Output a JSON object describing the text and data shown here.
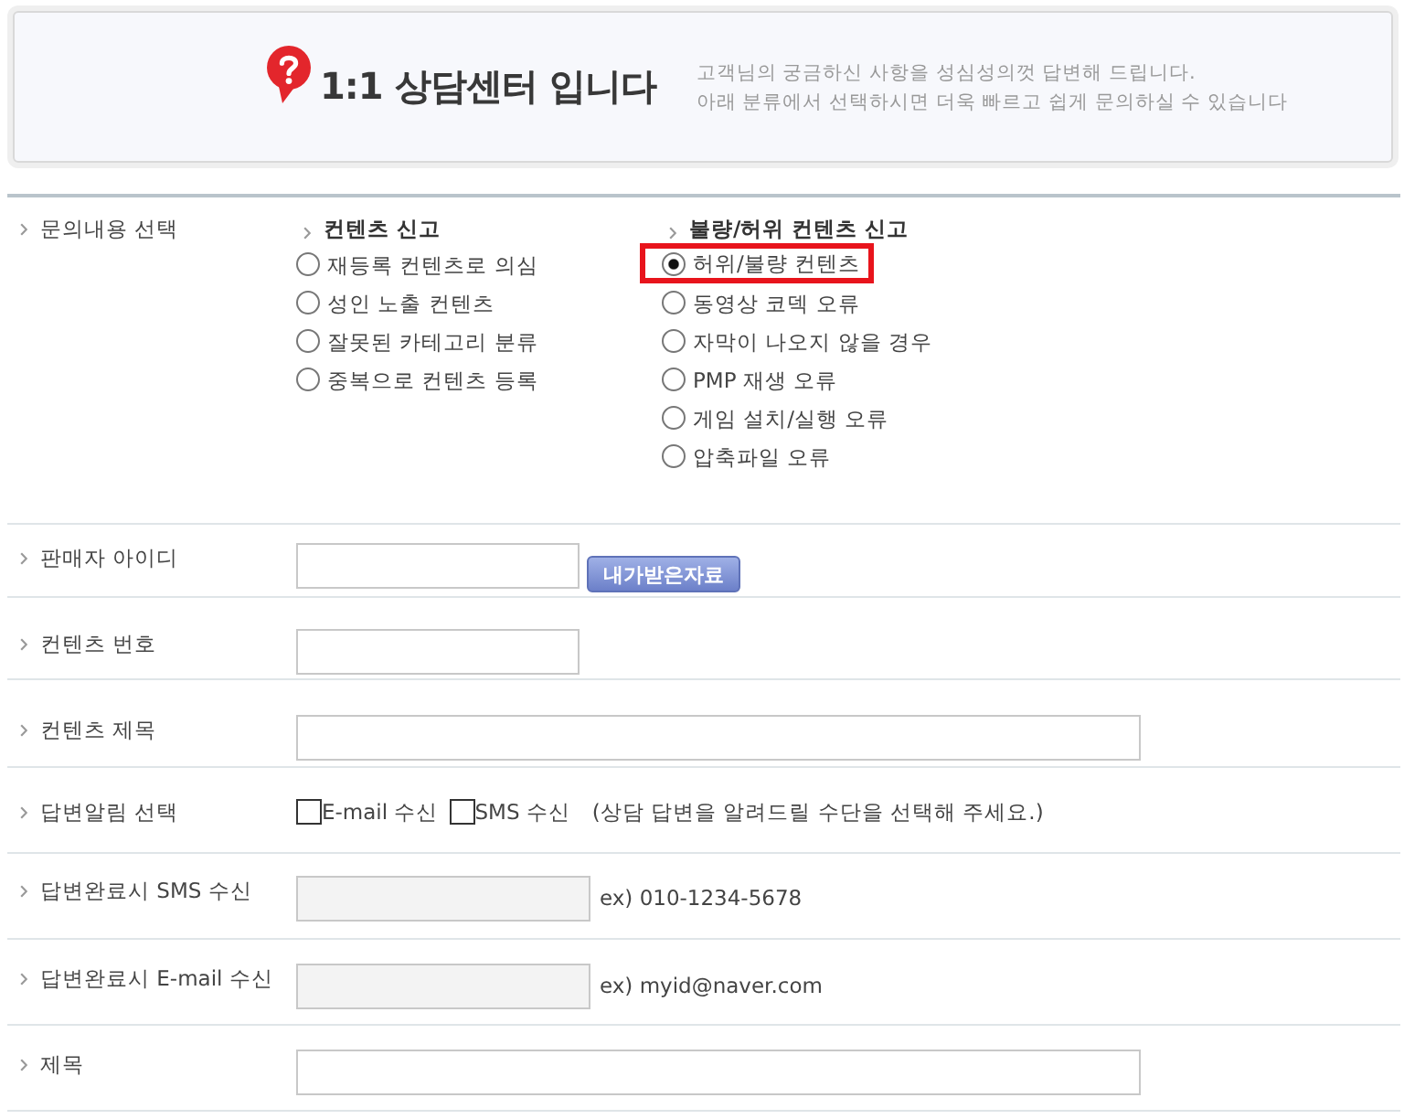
{
  "header": {
    "title": "1:1 상담센터 입니다",
    "description": [
      "고객님의 궁금하신 사항을 성심성의껏 답변해 드립니다.",
      "아래 분류에서 선택하시면 더욱 빠르고 쉽게 문의하실 수 있습니다"
    ]
  },
  "form": {
    "rows": [
      {
        "kind": "category_choice",
        "label": "문의내용 선택",
        "groups": [
          {
            "heading": "컨텐츠 신고",
            "options": [
              {
                "label": "재등록 컨텐츠로 의심",
                "selected": false,
                "highlighted": false
              },
              {
                "label": "성인 노출 컨텐츠",
                "selected": false,
                "highlighted": false
              },
              {
                "label": "잘못된 카테고리 분류",
                "selected": false,
                "highlighted": false
              },
              {
                "label": "중복으로 컨텐츠 등록",
                "selected": false,
                "highlighted": false
              }
            ]
          },
          {
            "heading": "불량/허위 컨텐츠 신고",
            "options": [
              {
                "label": "허위/불량 컨텐츠",
                "selected": true,
                "highlighted": true
              },
              {
                "label": "동영상 코덱 오류",
                "selected": false,
                "highlighted": false
              },
              {
                "label": "자막이 나오지 않을 경우",
                "selected": false,
                "highlighted": false
              },
              {
                "label": "PMP 재생 오류",
                "selected": false,
                "highlighted": false
              },
              {
                "label": "게임 설치/실행 오류",
                "selected": false,
                "highlighted": false
              },
              {
                "label": "압축파일 오류",
                "selected": false,
                "highlighted": false
              }
            ]
          }
        ]
      },
      {
        "kind": "short_field",
        "label": "판매자 아이디",
        "disabled": false,
        "button": "내가받은자료"
      },
      {
        "kind": "short_field",
        "label": "컨텐츠 번호",
        "disabled": false
      },
      {
        "kind": "wide_field",
        "label": "컨텐츠 제목",
        "disabled": false
      },
      {
        "kind": "checkboxes",
        "label": "답변알림 선택",
        "options": [
          {
            "label": "E-mail 수신",
            "checked": false
          },
          {
            "label": "SMS 수신",
            "checked": false
          }
        ],
        "note": "(상담 답변을 알려드릴 수단을 선택해 주세요.)"
      },
      {
        "kind": "short_field",
        "label": "답변완료시 SMS 수신",
        "disabled": true,
        "hint": "ex) 010-1234-5678"
      },
      {
        "kind": "short_field",
        "label": "답변완료시 E-mail 수신",
        "disabled": true,
        "hint": "ex) myid@naver.com"
      },
      {
        "kind": "wide_field",
        "label": "제목",
        "disabled": false
      }
    ]
  }
}
